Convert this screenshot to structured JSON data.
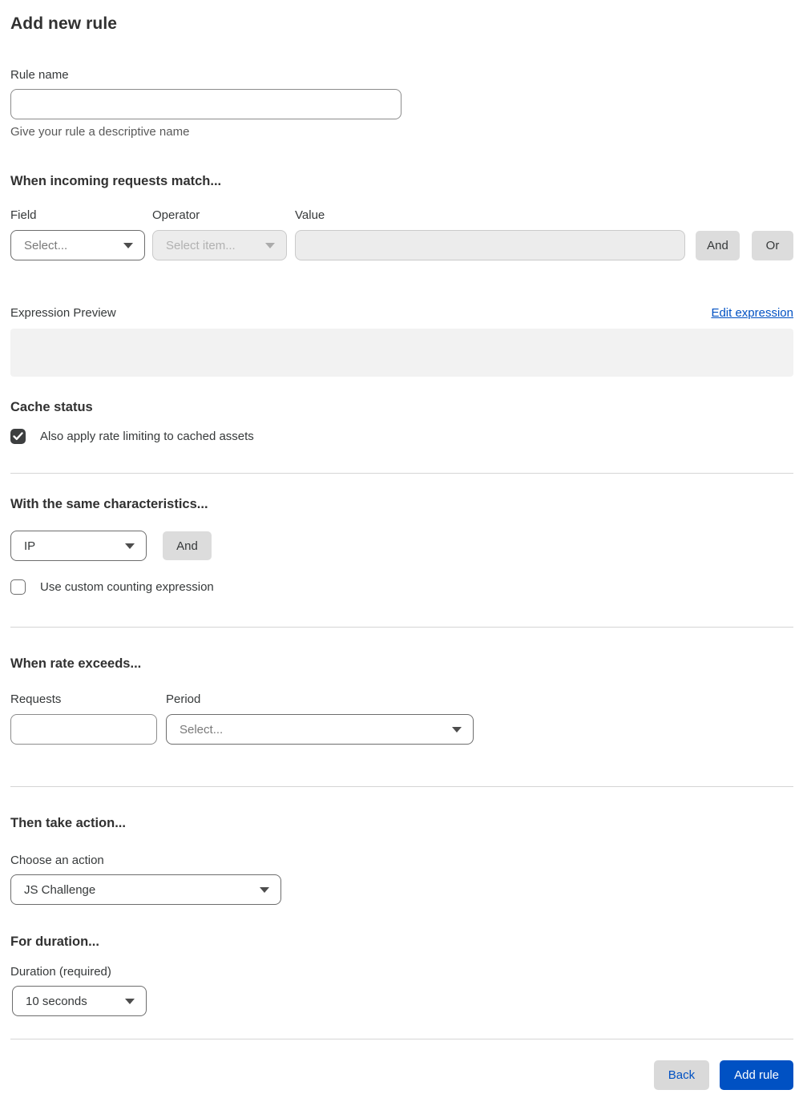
{
  "page": {
    "title": "Add new rule"
  },
  "colors": {
    "accent_blue": "#0051c3",
    "text_dark": "#313131",
    "helper_gray": "#595959",
    "button_gray": "#dcdcdc",
    "preview_box_gray": "#f2f2f2",
    "checkbox_checked": "#3d3f40"
  },
  "rule_name": {
    "label": "Rule name",
    "value": "",
    "helper": "Give your rule a descriptive name"
  },
  "match_section": {
    "heading": "When incoming requests match...",
    "field": {
      "label": "Field",
      "selected": "Select..."
    },
    "operator": {
      "label": "Operator",
      "selected": "Select item...",
      "disabled": true
    },
    "value": {
      "label": "Value",
      "value": "",
      "disabled": true
    },
    "and_button": "And",
    "or_button": "Or",
    "expression_preview_label": "Expression Preview",
    "edit_expression_link": "Edit expression",
    "expression_value": ""
  },
  "cache_section": {
    "heading": "Cache status",
    "checkbox_label": "Also apply rate limiting to cached assets",
    "checked": true
  },
  "characteristics_section": {
    "heading": "With the same characteristics...",
    "select_value": "IP",
    "and_button": "And",
    "checkbox_label": "Use custom counting expression",
    "checked": false
  },
  "rate_section": {
    "heading": "When rate exceeds...",
    "requests": {
      "label": "Requests",
      "value": ""
    },
    "period": {
      "label": "Period",
      "selected": "Select..."
    }
  },
  "action_section": {
    "heading": "Then take action...",
    "label": "Choose an action",
    "selected": "JS Challenge"
  },
  "duration_section": {
    "heading": "For duration...",
    "label": "Duration (required)",
    "selected": "10 seconds"
  },
  "footer": {
    "back_button": "Back",
    "add_rule_button": "Add rule"
  }
}
